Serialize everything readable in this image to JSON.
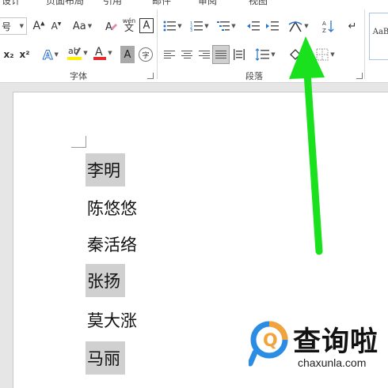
{
  "ribbon": {
    "tabs": [
      "设计",
      "页面布局",
      "引用",
      "邮件",
      "审阅",
      "视图"
    ],
    "font_size_value": "号",
    "font_group_label": "字体",
    "paragraph_group_label": "段落",
    "change_case_label": "Aa",
    "superscript_label": "x²",
    "subscript_label": "x₂",
    "phonetic_label": "wén",
    "enclose_char_label": "字",
    "style_preview": "AaB"
  },
  "document": {
    "lines": [
      {
        "text": "李明",
        "selected": true
      },
      {
        "text": "陈悠悠",
        "selected": false
      },
      {
        "text": "秦活络",
        "selected": false
      },
      {
        "text": "张扬",
        "selected": true
      },
      {
        "text": "莫大涨",
        "selected": false
      },
      {
        "text": "马丽",
        "selected": true
      }
    ]
  },
  "watermark": {
    "title": "查询啦",
    "url": "chaxunla.com"
  },
  "colors": {
    "arrow": "#19e11e",
    "font_color": "#e52b2b",
    "highlight": "#ffef00",
    "selection": "#d0d0d0",
    "watermark_orange": "#f3a33a",
    "watermark_blue": "#2b8ce4"
  }
}
